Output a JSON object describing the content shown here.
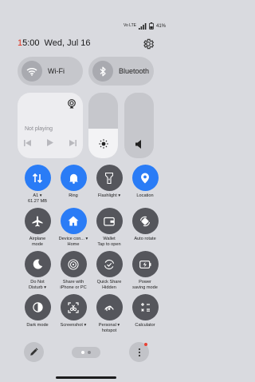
{
  "status_bar": {
    "signal_text": "Vo LTE",
    "net_speed": "0.00 KB/S",
    "battery": "41%"
  },
  "header": {
    "time": "15:00",
    "time_red": "1",
    "time_rest": "5:00",
    "date": "Wed, Jul 16"
  },
  "pills": {
    "wifi": "Wi-Fi",
    "bluetooth": "Bluetooth"
  },
  "media": {
    "status": "Not playing"
  },
  "sliders": {
    "brightness_level": 0.45,
    "volume_level": 0.0
  },
  "tiles": [
    {
      "line1": "A1 ▾",
      "line2": "61.27 MB",
      "state": "on"
    },
    {
      "line1": "Ring",
      "line2": "",
      "state": "on"
    },
    {
      "line1": "Flashlight ▾",
      "line2": "",
      "state": "off"
    },
    {
      "line1": "Location",
      "line2": "",
      "state": "on"
    },
    {
      "line1": "Airplane",
      "line2": "mode",
      "state": "off"
    },
    {
      "line1": "Device con... ▾",
      "line2": "Home",
      "state": "on"
    },
    {
      "line1": "Wallet",
      "line2": "Tap to open",
      "state": "off"
    },
    {
      "line1": "Auto rotate",
      "line2": "",
      "state": "off"
    },
    {
      "line1": "Do Not",
      "line2": "Disturb ▾",
      "state": "off"
    },
    {
      "line1": "Share with",
      "line2": "iPhone or PC",
      "state": "off"
    },
    {
      "line1": "Quick Share",
      "line2": "Hidden",
      "state": "off"
    },
    {
      "line1": "Power",
      "line2": "saving mode",
      "state": "off"
    },
    {
      "line1": "Dark mode",
      "line2": "",
      "state": "off"
    },
    {
      "line1": "Screenshot ▾",
      "line2": "",
      "state": "off"
    },
    {
      "line1": "Personal ▾",
      "line2": "hotspot",
      "state": "off"
    },
    {
      "line1": "Calculator",
      "line2": "",
      "state": "off"
    }
  ],
  "colors": {
    "active": "#2a7cf6",
    "inactive": "#55565c",
    "badge": "#e84133"
  }
}
